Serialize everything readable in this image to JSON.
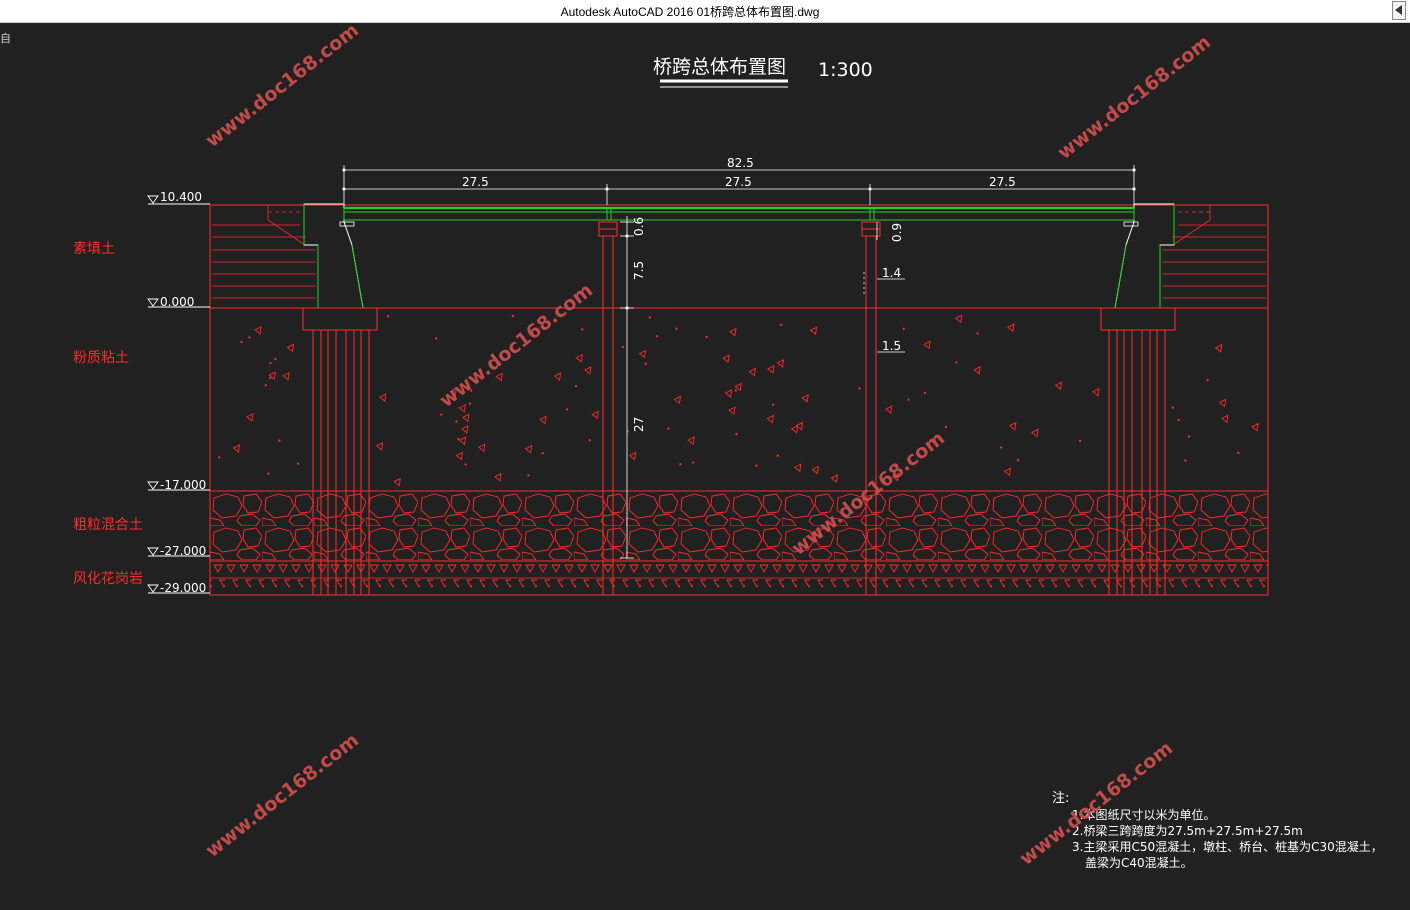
{
  "window": {
    "title": "Autodesk AutoCAD 2016      01桥跨总体布置图.dwg",
    "corner_glyph": "自"
  },
  "drawing": {
    "title": "桥跨总体布置图",
    "scale": "1:300",
    "dimensions": {
      "total": "82.5",
      "span1": "27.5",
      "span2": "27.5",
      "span3": "27.5",
      "cap_height": "0.6",
      "cap_height_right": "0.9",
      "pier_height": "7.5",
      "pile_length": "27",
      "pier_width": "1.4",
      "pile_width": "1.5"
    },
    "elevations": {
      "top": "10.400",
      "ground": "0.000",
      "e17": "-17.000",
      "e27": "-27.000",
      "e29": "-29.000"
    },
    "layers": {
      "fill": "素填土",
      "clay": "粉质粘土",
      "gravel": "粗粒混合土",
      "granite": "风化花岗岩"
    },
    "notes": {
      "heading": "注:",
      "line1": "1.本图纸尺寸以米为单位。",
      "line2": "2.桥梁三跨跨度为27.5m+27.5m+27.5m",
      "line3": "3.主梁采用C50混凝土，墩柱、桥台、桩基为C30混凝土，",
      "line4": "盖梁为C40混凝土。"
    },
    "watermark": "www.doc168.com"
  },
  "colors": {
    "background": "#212121",
    "structure_red": "#ff2a2a",
    "girder_green": "#1fd31f",
    "text_white": "#ffffff"
  }
}
